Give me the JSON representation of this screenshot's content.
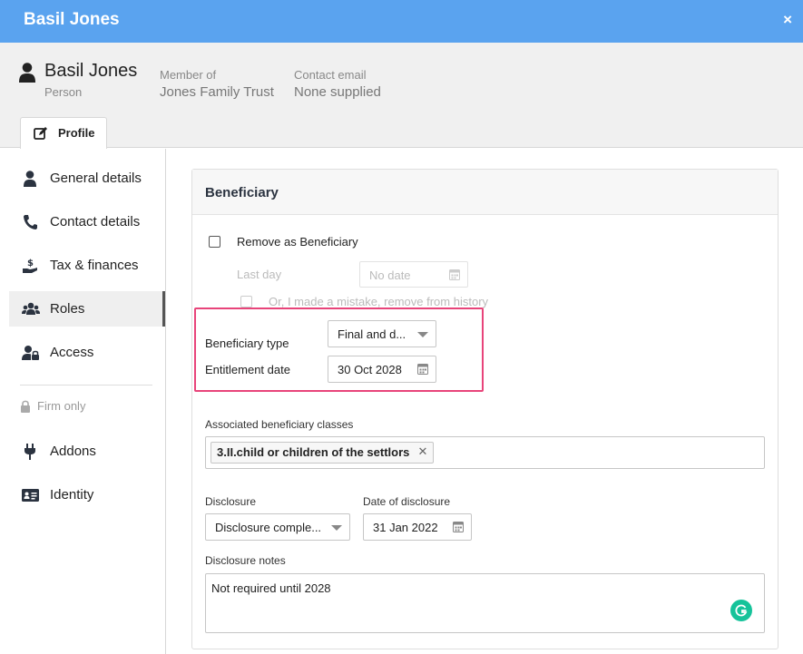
{
  "window": {
    "title": "Basil Jones",
    "close_label": "×"
  },
  "person": {
    "name": "Basil Jones",
    "type": "Person",
    "member_of_label": "Member of",
    "member_of_value": "Jones Family Trust",
    "contact_email_label": "Contact email",
    "contact_email_value": "None supplied"
  },
  "tabs": {
    "profile": "Profile"
  },
  "sidebar": {
    "items": [
      {
        "label": "General details",
        "icon": "person-icon"
      },
      {
        "label": "Contact details",
        "icon": "phone-icon"
      },
      {
        "label": "Tax & finances",
        "icon": "hand-dollar-icon"
      },
      {
        "label": "Roles",
        "icon": "users-icon",
        "active": true
      },
      {
        "label": "Access",
        "icon": "user-lock-icon"
      }
    ],
    "firm_only": "Firm only",
    "firm_items": [
      {
        "label": "Addons",
        "icon": "plug-icon"
      },
      {
        "label": "Identity",
        "icon": "id-card-icon"
      }
    ]
  },
  "beneficiary": {
    "header": "Beneficiary",
    "remove_label": "Remove as Beneficiary",
    "last_day_label": "Last day",
    "last_day_placeholder": "No date",
    "mistake_label": "Or, I made a mistake, remove from history",
    "type_label": "Beneficiary type",
    "type_value": "Final and d...",
    "entitlement_label": "Entitlement date",
    "entitlement_value": "30 Oct 2028",
    "classes_label": "Associated beneficiary classes",
    "classes": [
      "3.II.child or children of the settlors"
    ],
    "disclosure_label": "Disclosure",
    "disclosure_value": "Disclosure comple...",
    "date_of_disclosure_label": "Date of disclosure",
    "date_of_disclosure_value": "31 Jan 2022",
    "notes_label": "Disclosure notes",
    "notes_value": "Not required until 2028"
  },
  "colors": {
    "titlebar": "#5aa3ef",
    "highlight": "#e8447a",
    "grammarly": "#15c39a"
  }
}
